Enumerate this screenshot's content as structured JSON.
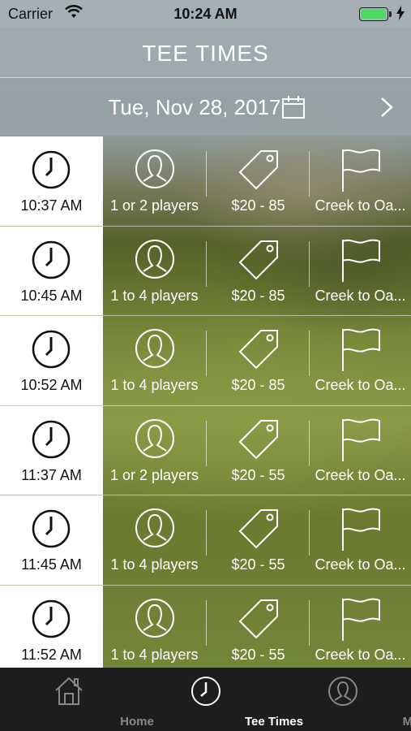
{
  "status_bar": {
    "carrier": "Carrier",
    "time": "10:24 AM"
  },
  "header": {
    "title": "TEE TIMES"
  },
  "date_bar": {
    "date": "Tue, Nov 28, 2017"
  },
  "tee_times": [
    {
      "time": "10:37 AM",
      "players": "1 or 2 players",
      "price": "$20 - 85",
      "course": "Creek to Oa..."
    },
    {
      "time": "10:45 AM",
      "players": "1 to 4 players",
      "price": "$20 - 85",
      "course": "Creek to Oa..."
    },
    {
      "time": "10:52 AM",
      "players": "1 to 4 players",
      "price": "$20 - 85",
      "course": "Creek to Oa..."
    },
    {
      "time": "11:37 AM",
      "players": "1 or 2 players",
      "price": "$20 - 55",
      "course": "Creek to Oa..."
    },
    {
      "time": "11:45 AM",
      "players": "1 to 4 players",
      "price": "$20 - 55",
      "course": "Creek to Oa..."
    },
    {
      "time": "11:52 AM",
      "players": "1 to 4 players",
      "price": "$20 - 55",
      "course": "Creek to Oa..."
    }
  ],
  "tab_bar": {
    "home": "Home",
    "tee_times": "Tee Times",
    "me": "Me",
    "active": "tee_times"
  },
  "icons": {
    "row_time": "clock-icon",
    "row_players": "person-icon",
    "row_price": "price-tag-icon",
    "row_course": "flag-icon",
    "tab_home": "home-icon",
    "tab_tee_times": "clock-icon",
    "tab_me": "person-icon"
  },
  "colors": {
    "battery": "#4cd964",
    "tab_bar": "#1d1d1d",
    "time_cell": "#ffffff"
  }
}
